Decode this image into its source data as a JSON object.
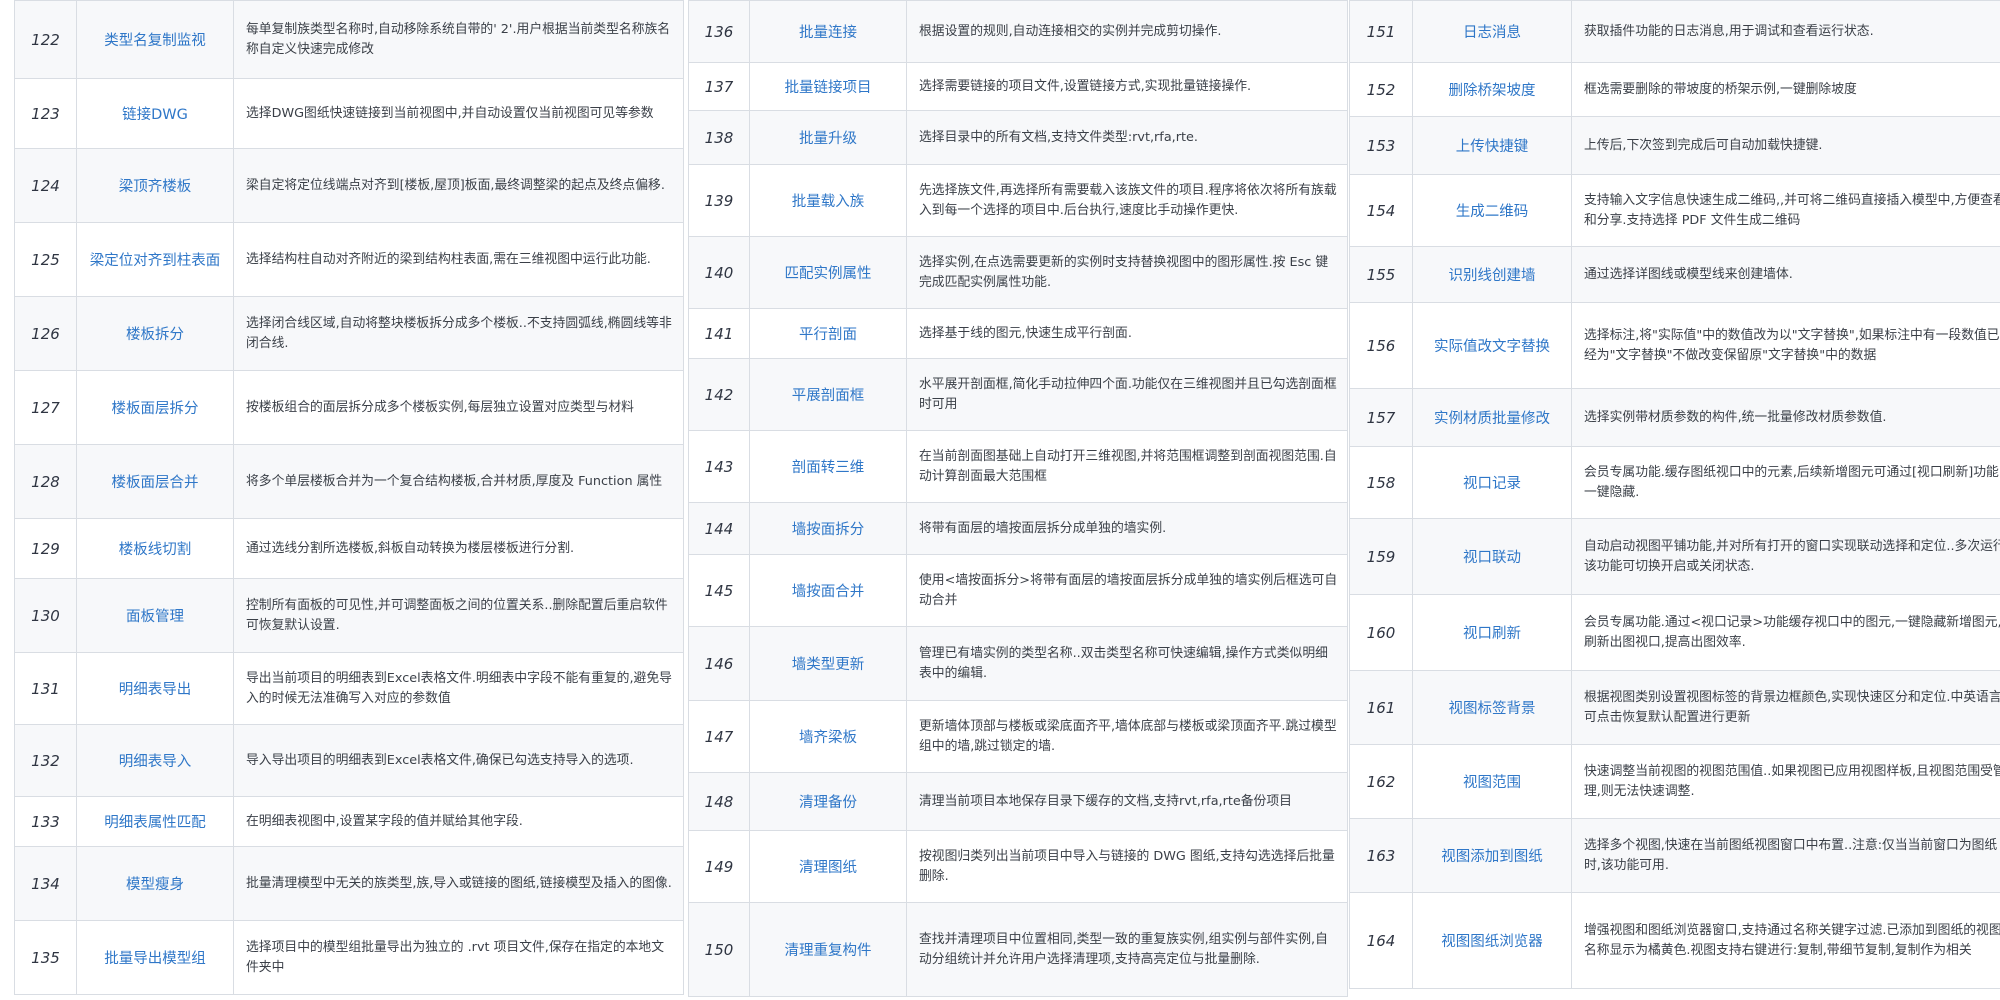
{
  "columns": [
    {
      "rows": [
        {
          "num": "122",
          "name": "类型名复制监视",
          "desc": "每单复制族类型名称时,自动移除系统自带的' 2'.用户根据当前类型名称族名称自定义快速完成修改"
        },
        {
          "num": "123",
          "name": "链接DWG",
          "desc": "选择DWG图纸快速链接到当前视图中,并自动设置仅当前视图可见等参数"
        },
        {
          "num": "124",
          "name": "梁顶齐楼板",
          "desc": "梁自定将定位线端点对齐到[楼板,屋顶]板面,最终调整梁的起点及终点偏移."
        },
        {
          "num": "125",
          "name": "梁定位对齐到柱表面",
          "desc": "选择结构柱自动对齐附近的梁到结构柱表面,需在三维视图中运行此功能."
        },
        {
          "num": "126",
          "name": "楼板拆分",
          "desc": "选择闭合线区域,自动将整块楼板拆分成多个楼板..不支持圆弧线,椭圆线等非闭合线."
        },
        {
          "num": "127",
          "name": "楼板面层拆分",
          "desc": "按楼板组合的面层拆分成多个楼板实例,每层独立设置对应类型与材料"
        },
        {
          "num": "128",
          "name": "楼板面层合并",
          "desc": "将多个单层楼板合并为一个复合结构楼板,合并材质,厚度及 Function 属性"
        },
        {
          "num": "129",
          "name": "楼板线切割",
          "desc": "通过选线分割所选楼板,斜板自动转换为楼层楼板进行分割."
        },
        {
          "num": "130",
          "name": "面板管理",
          "desc": "控制所有面板的可见性,并可调整面板之间的位置关系..删除配置后重启软件可恢复默认设置."
        },
        {
          "num": "131",
          "name": "明细表导出",
          "desc": "导出当前项目的明细表到Excel表格文件.明细表中字段不能有重复的,避免导入的时候无法准确写入对应的参数值"
        },
        {
          "num": "132",
          "name": "明细表导入",
          "desc": "导入导出项目的明细表到Excel表格文件,确保已勾选支持导入的选项."
        },
        {
          "num": "133",
          "name": "明细表属性匹配",
          "desc": "在明细表视图中,设置某字段的值并赋给其他字段."
        },
        {
          "num": "134",
          "name": "模型瘦身",
          "desc": "批量清理模型中无关的族类型,族,导入或链接的图纸,链接模型及插入的图像."
        },
        {
          "num": "135",
          "name": "批量导出模型组",
          "desc": "选择项目中的模型组批量导出为独立的 .rvt 项目文件,保存在指定的本地文件夹中"
        }
      ]
    },
    {
      "rows": [
        {
          "num": "136",
          "name": "批量连接",
          "desc": "根据设置的规则,自动连接相交的实例并完成剪切操作."
        },
        {
          "num": "137",
          "name": "批量链接项目",
          "desc": "选择需要链接的项目文件,设置链接方式,实现批量链接操作."
        },
        {
          "num": "138",
          "name": "批量升级",
          "desc": "选择目录中的所有文档,支持文件类型:rvt,rfa,rte."
        },
        {
          "num": "139",
          "name": "批量载入族",
          "desc": "先选择族文件,再选择所有需要载入该族文件的项目.程序将依次将所有族载入到每一个选择的项目中.后台执行,速度比手动操作更快."
        },
        {
          "num": "140",
          "name": "匹配实例属性",
          "desc": "选择实例,在点选需要更新的实例时支持替换视图中的图形属性.按 Esc 键完成匹配实例属性功能."
        },
        {
          "num": "141",
          "name": "平行剖面",
          "desc": "选择基于线的图元,快速生成平行剖面."
        },
        {
          "num": "142",
          "name": "平展剖面框",
          "desc": "水平展开剖面框,简化手动拉伸四个面.功能仅在三维视图并且已勾选剖面框时可用"
        },
        {
          "num": "143",
          "name": "剖面转三维",
          "desc": "在当前剖面图基础上自动打开三维视图,并将范围框调整到剖面视图范围.自动计算剖面最大范围框"
        },
        {
          "num": "144",
          "name": "墙按面拆分",
          "desc": "将带有面层的墙按面层拆分成单独的墙实例."
        },
        {
          "num": "145",
          "name": "墙按面合并",
          "desc": "使用<墙按面拆分>将带有面层的墙按面层拆分成单独的墙实例后框选可自动合并"
        },
        {
          "num": "146",
          "name": "墙类型更新",
          "desc": "管理已有墙实例的类型名称..双击类型名称可快速编辑,操作方式类似明细表中的编辑."
        },
        {
          "num": "147",
          "name": "墙齐梁板",
          "desc": "更新墙体顶部与楼板或梁底面齐平,墙体底部与楼板或梁顶面齐平.跳过模型组中的墙,跳过锁定的墙."
        },
        {
          "num": "148",
          "name": "清理备份",
          "desc": "清理当前项目本地保存目录下缓存的文档,支持rvt,rfa,rte备份项目"
        },
        {
          "num": "149",
          "name": "清理图纸",
          "desc": "按视图归类列出当前项目中导入与链接的 DWG 图纸,支持勾选选择后批量删除."
        },
        {
          "num": "150",
          "name": "清理重复构件",
          "desc": "查找并清理项目中位置相同,类型一致的重复族实例,组实例与部件实例,自动分组统计并允许用户选择清理项,支持高亮定位与批量删除."
        }
      ]
    },
    {
      "rows": [
        {
          "num": "151",
          "name": "日志消息",
          "desc": "获取插件功能的日志消息,用于调试和查看运行状态."
        },
        {
          "num": "152",
          "name": "删除桥架坡度",
          "desc": "框选需要删除的带坡度的桥架示例,一键删除坡度"
        },
        {
          "num": "153",
          "name": "上传快捷键",
          "desc": "上传后,下次签到完成后可自动加载快捷键."
        },
        {
          "num": "154",
          "name": "生成二维码",
          "desc": "支持输入文字信息快速生成二维码,,并可将二维码直接插入模型中,方便查看和分享.支持选择 PDF 文件生成二维码"
        },
        {
          "num": "155",
          "name": "识别线创建墙",
          "desc": "通过选择详图线或模型线来创建墙体."
        },
        {
          "num": "156",
          "name": "实际值改文字替换",
          "desc": "选择标注,将\"实际值\"中的数值改为以\"文字替换\",如果标注中有一段数值已经为\"文字替换\"不做改变保留原\"文字替换\"中的数据"
        },
        {
          "num": "157",
          "name": "实例材质批量修改",
          "desc": "选择实例带材质参数的构件,统一批量修改材质参数值."
        },
        {
          "num": "158",
          "name": "视口记录",
          "desc": "会员专属功能.缓存图纸视口中的元素,后续新增图元可通过[视口刷新]功能一键隐藏."
        },
        {
          "num": "159",
          "name": "视口联动",
          "desc": "自动启动视图平铺功能,并对所有打开的窗口实现联动选择和定位..多次运行该功能可切换开启或关闭状态."
        },
        {
          "num": "160",
          "name": "视口刷新",
          "desc": "会员专属功能.通过<视口记录>功能缓存视口中的图元,一键隐藏新增图元,刷新出图视口,提高出图效率."
        },
        {
          "num": "161",
          "name": "视图标签背景",
          "desc": "根据视图类别设置视图标签的背景边框颜色,实现快速区分和定位.中英语言可点击恢复默认配置进行更新"
        },
        {
          "num": "162",
          "name": "视图范围",
          "desc": "快速调整当前视图的视图范围值..如果视图已应用视图样板,且视图范围受管理,则无法快速调整."
        },
        {
          "num": "163",
          "name": "视图添加到图纸",
          "desc": "选择多个视图,快速在当前图纸视图窗口中布置..注意:仅当当前窗口为图纸时,该功能可用."
        },
        {
          "num": "164",
          "name": "视图图纸浏览器",
          "desc": "增强视图和图纸浏览器窗口,支持通过名称关键字过滤.已添加到图纸的视图名称显示为橘黄色.视图支持右键进行:复制,带细节复制,复制作为相关"
        }
      ]
    }
  ]
}
